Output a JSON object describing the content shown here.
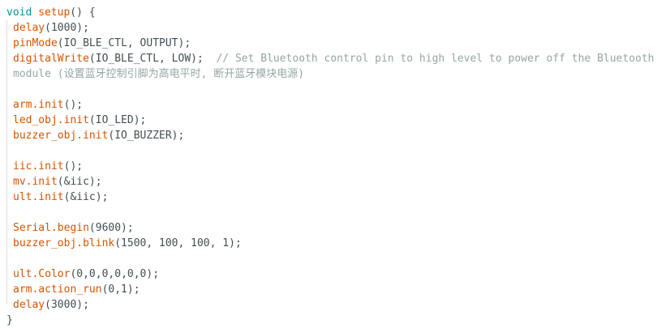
{
  "code": {
    "l1": {
      "kw": "void",
      "fn": "setup",
      "rest": "() {"
    },
    "l2": {
      "fn": "delay",
      "rest": "(1000);"
    },
    "l3": {
      "fn": "pinMode",
      "rest": "(IO_BLE_CTL, OUTPUT);"
    },
    "l4": {
      "fn": "digitalWrite",
      "rest": "(IO_BLE_CTL, LOW);  ",
      "comment": "// Set Bluetooth control pin to high level to power off the Bluetooth"
    },
    "l5": {
      "comment": "module (设置蓝牙控制引脚为高电平时, 断开蓝牙模块电源)"
    },
    "l7": {
      "fn": "arm.init",
      "rest": "();"
    },
    "l8": {
      "fn": "led_obj.init",
      "rest": "(IO_LED);"
    },
    "l9": {
      "fn": "buzzer_obj.init",
      "rest": "(IO_BUZZER);"
    },
    "l11": {
      "fn": "iic.init",
      "rest": "();"
    },
    "l12": {
      "fn": "mv.init",
      "rest": "(&iic);"
    },
    "l13": {
      "fn": "ult.init",
      "rest": "(&iic);"
    },
    "l15": {
      "fn": "Serial.begin",
      "rest": "(9600);"
    },
    "l16": {
      "fn": "buzzer_obj.blink",
      "rest": "(1500, 100, 100, 1);"
    },
    "l18": {
      "fn": "ult.Color",
      "rest": "(0,0,0,0,0,0);"
    },
    "l19": {
      "fn": "arm.action_run",
      "rest": "(0,1);"
    },
    "l20": {
      "fn": "delay",
      "rest": "(3000);"
    },
    "l21": {
      "rest": "}"
    }
  },
  "colors": {
    "keyword": "#00979c",
    "function": "#d35400",
    "comment": "#95a5a6",
    "text": "#434f54"
  }
}
